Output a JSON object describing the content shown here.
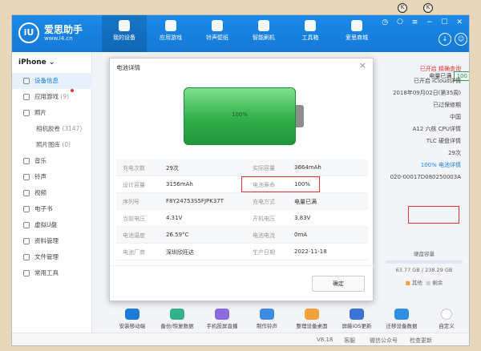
{
  "brand": {
    "name": "爱思助手",
    "url": "www.i4.cn",
    "logo_text": "iU"
  },
  "nav_tabs": [
    {
      "label": "我的设备",
      "active": true
    },
    {
      "label": "应用游戏"
    },
    {
      "label": "铃声壁纸"
    },
    {
      "label": "智能刷机"
    },
    {
      "label": "工具箱"
    },
    {
      "label": "爱思商城"
    }
  ],
  "sidebar": {
    "device": "iPhone ⌄",
    "items": [
      {
        "label": "设备信息",
        "active": true
      },
      {
        "label": "应用游戏",
        "count": "(9)"
      },
      {
        "label": "照片"
      },
      {
        "label": "相机胶卷",
        "count": "(3147)"
      },
      {
        "label": "照片图库",
        "count": "(0)"
      },
      {
        "label": "音乐"
      },
      {
        "label": "铃声"
      },
      {
        "label": "视频"
      },
      {
        "label": "电子书"
      },
      {
        "label": "虚拟U盘"
      },
      {
        "label": "资料管理"
      },
      {
        "label": "文件管理"
      },
      {
        "label": "常用工具"
      }
    ]
  },
  "right_info": {
    "battery_label": "电量已满",
    "battery_value": "100",
    "rows": [
      "已开启 精确查询",
      "已开启 iCloud详情",
      "2018年09月02日(第35周)",
      "已过保修期",
      "中国",
      "A12 六核 CPU详情",
      "TLC 硬盘详情",
      "29次",
      "100% 电池详情",
      "020-00017D080250003A"
    ],
    "disk_title": "硬盘容量",
    "disk_value": "63.77 GB / 238.29 GB",
    "legend": [
      "其他",
      "剩余"
    ]
  },
  "tools": [
    {
      "label": "安装移动端",
      "color": "#1e7ad8"
    },
    {
      "label": "备份/恢复数据",
      "color": "#34b38a"
    },
    {
      "label": "手机投屏直播",
      "color": "#8a6be0"
    },
    {
      "label": "制作铃声",
      "color": "#3f8be0"
    },
    {
      "label": "整理设备桌面",
      "color": "#f2a23a"
    },
    {
      "label": "屏蔽iOS更新",
      "color": "#3a74d6"
    },
    {
      "label": "迁移设备数据",
      "color": "#2f8fe6"
    },
    {
      "label": "自定义",
      "color": "#c8c8c8"
    }
  ],
  "footer": {
    "version": "V8.18",
    "feedback": "客服",
    "wechat": "微信公众号",
    "update": "检查更新"
  },
  "modal": {
    "title": "电池详情",
    "close": "×",
    "battery_percent": "100%",
    "rows": [
      {
        "l1": "充电次数",
        "v1": "29次",
        "l2": "实际容量",
        "v2": "3664mAh"
      },
      {
        "l1": "设计容量",
        "v1": "3156mAh",
        "l2": "电池寿命",
        "v2": "100%"
      },
      {
        "l1": "序列号",
        "v1": "F8Y24753S5FJPK37T",
        "l2": "充电方式",
        "v2": "电量已满"
      },
      {
        "l1": "当前电压",
        "v1": "4.31V",
        "l2": "开机电压",
        "v2": "3.83V"
      },
      {
        "l1": "电池温度",
        "v1": "26.59°C",
        "l2": "电池电流",
        "v2": "0mA"
      },
      {
        "l1": "电池厂商",
        "v1": "深圳欣旺达",
        "l2": "生产日期",
        "v2": "2022-11-18"
      }
    ],
    "ok": "确定"
  }
}
